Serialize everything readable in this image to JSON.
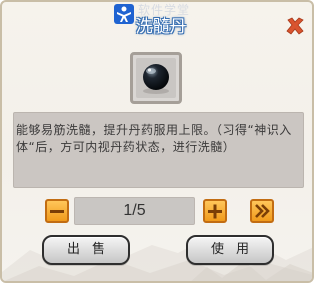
{
  "title": "洗髓丹",
  "title_watermark": "软件学堂",
  "item": {
    "icon": "black-pill-icon"
  },
  "description": "能够易筋洗髓，提升丹药服用上限。（习得“神识入体“后，方可内视丹药状态，进行洗髓）",
  "quantity": {
    "display": "1/5"
  },
  "buttons": {
    "sell_label": "出售",
    "use_label": "使用"
  },
  "colors": {
    "title_blue": "#3a71b3",
    "close_red": "#d64a2a",
    "stepper_orange": "#f3a12b",
    "description_bg": "#cbc6c2",
    "panel_bg": "#f4f1eb"
  }
}
